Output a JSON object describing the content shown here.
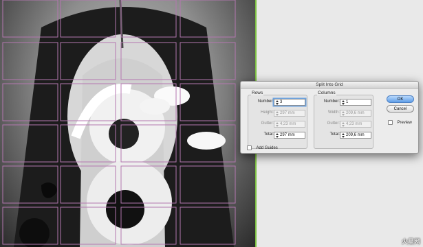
{
  "dialog": {
    "title": "Split Into Grid",
    "rows": {
      "group_label": "Rows",
      "number_label": "Number:",
      "number_value": "3",
      "height_label": "Height:",
      "height_value": "297 mm",
      "gutter_label": "Gutter:",
      "gutter_value": "4,23 mm",
      "total_label": "Total:",
      "total_value": "297 mm"
    },
    "columns": {
      "group_label": "Columns",
      "number_label": "Number:",
      "number_value": "1",
      "width_label": "Width:",
      "width_value": "209,6 mm",
      "gutter_label": "Gutter:",
      "gutter_value": "4,23 mm",
      "total_label": "Total:",
      "total_value": "209,6 mm"
    },
    "ok_label": "OK",
    "cancel_label": "Cancel",
    "preview_label": "Preview",
    "add_guides_label": "Add Guides"
  },
  "watermark": {
    "text": "火星网",
    "sub": "hxsd.com"
  },
  "colors": {
    "grid_line": "#b477b0",
    "page_edge": "#7dc142",
    "ok_button": "#5f9ee8"
  }
}
